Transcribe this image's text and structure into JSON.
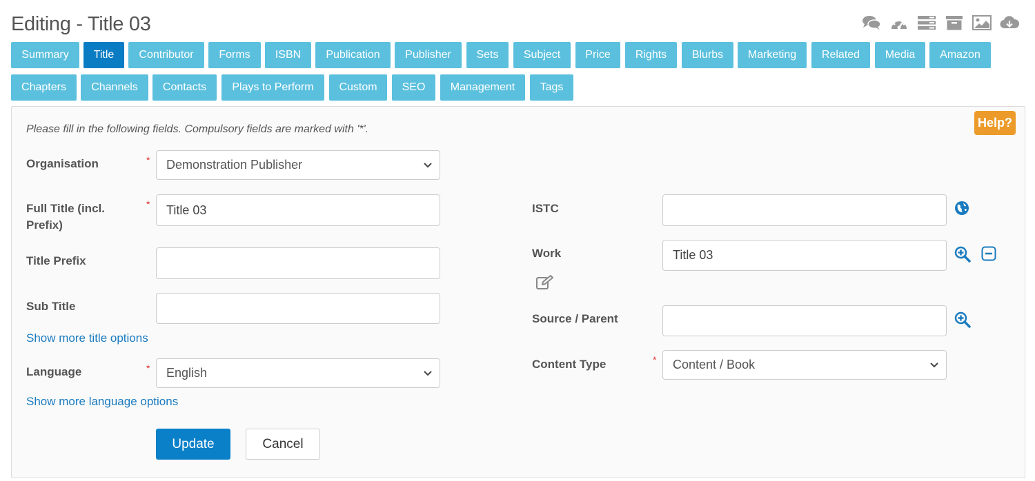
{
  "header": {
    "title": "Editing - Title 03",
    "icons": [
      "chat-icon",
      "dashboard-icon",
      "server-icon",
      "archive-icon",
      "image-icon",
      "cloud-download-icon"
    ]
  },
  "tabs": [
    {
      "label": "Summary"
    },
    {
      "label": "Title",
      "active": true
    },
    {
      "label": "Contributor"
    },
    {
      "label": "Forms"
    },
    {
      "label": "ISBN"
    },
    {
      "label": "Publication"
    },
    {
      "label": "Publisher"
    },
    {
      "label": "Sets"
    },
    {
      "label": "Subject"
    },
    {
      "label": "Price"
    },
    {
      "label": "Rights"
    },
    {
      "label": "Blurbs"
    },
    {
      "label": "Marketing"
    },
    {
      "label": "Related"
    },
    {
      "label": "Media"
    },
    {
      "label": "Amazon"
    },
    {
      "label": "Chapters"
    },
    {
      "label": "Channels"
    },
    {
      "label": "Contacts"
    },
    {
      "label": "Plays to Perform"
    },
    {
      "label": "Custom"
    },
    {
      "label": "SEO"
    },
    {
      "label": "Management"
    },
    {
      "label": "Tags"
    }
  ],
  "form": {
    "help_label": "Help?",
    "instructions": "Please fill in the following fields. Compulsory fields are marked with '*'.",
    "required_mark": "*",
    "organisation": {
      "label": "Organisation",
      "value": "Demonstration Publisher"
    },
    "full_title": {
      "label": "Full Title (incl. Prefix)",
      "value": "Title 03"
    },
    "title_prefix": {
      "label": "Title Prefix",
      "value": ""
    },
    "sub_title": {
      "label": "Sub Title",
      "value": ""
    },
    "more_title_link": "Show more title options",
    "language": {
      "label": "Language",
      "value": "English"
    },
    "more_language_link": "Show more language options",
    "istc": {
      "label": "ISTC",
      "value": ""
    },
    "work": {
      "label": "Work",
      "value": "Title 03"
    },
    "source_parent": {
      "label": "Source / Parent",
      "value": ""
    },
    "content_type": {
      "label": "Content Type",
      "value": "Content / Book"
    },
    "update_label": "Update",
    "cancel_label": "Cancel"
  },
  "colors": {
    "tab": "#5bc0de",
    "tab_active": "#0a7cc4",
    "help": "#ec9b2a",
    "primary": "#0a80c9",
    "link": "#1a7bbf",
    "required": "#e03030"
  }
}
